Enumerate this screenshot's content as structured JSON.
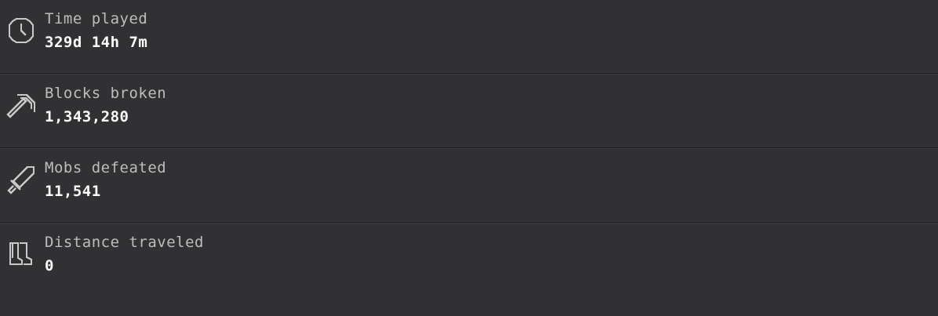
{
  "stats": [
    {
      "icon": "clock-icon",
      "label": "Time played",
      "value": "329d 14h 7m"
    },
    {
      "icon": "pickaxe-icon",
      "label": "Blocks broken",
      "value": "1,343,280"
    },
    {
      "icon": "sword-icon",
      "label": "Mobs defeated",
      "value": "11,541"
    },
    {
      "icon": "boots-icon",
      "label": "Distance traveled",
      "value": "0"
    }
  ],
  "colors": {
    "background": "#313133",
    "divider": "#1e1e1f",
    "label": "#bdbdbd",
    "value": "#ffffff",
    "icon": "#c8c8c8"
  }
}
